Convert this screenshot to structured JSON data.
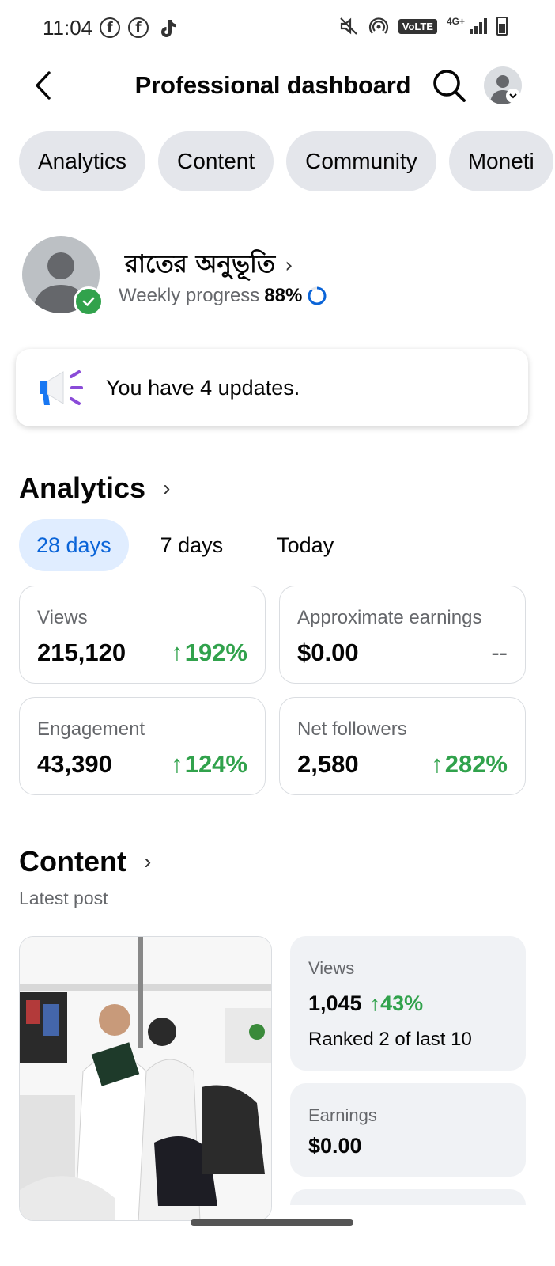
{
  "status_bar": {
    "time": "11:04",
    "network": "4G+",
    "volte": "VoLTE",
    "icons": [
      "facebook-icon",
      "facebook-icon",
      "tiktok-icon",
      "mute-icon",
      "hotspot-icon",
      "signal-icon",
      "battery-icon"
    ]
  },
  "header": {
    "title": "Professional dashboard"
  },
  "tabs": [
    {
      "label": "Analytics"
    },
    {
      "label": "Content"
    },
    {
      "label": "Community"
    },
    {
      "label": "Moneti"
    }
  ],
  "profile": {
    "name": "রাতের অনুভূতি",
    "progress_label": "Weekly progress",
    "progress_value": "88%",
    "progress_fraction": 0.88
  },
  "updates": {
    "text": "You have 4 updates."
  },
  "analytics": {
    "title": "Analytics",
    "ranges": [
      {
        "label": "28 days",
        "active": true
      },
      {
        "label": "7 days",
        "active": false
      },
      {
        "label": "Today",
        "active": false
      }
    ],
    "stats": [
      {
        "label": "Views",
        "value": "215,120",
        "change": "192%",
        "trend": "up"
      },
      {
        "label": "Approximate earnings",
        "value": "$0.00",
        "change": "--",
        "trend": "flat"
      },
      {
        "label": "Engagement",
        "value": "43,390",
        "change": "124%",
        "trend": "up"
      },
      {
        "label": "Net followers",
        "value": "2,580",
        "change": "282%",
        "trend": "up"
      }
    ]
  },
  "content": {
    "title": "Content",
    "subtitle": "Latest post",
    "views": {
      "label": "Views",
      "value": "1,045",
      "change": "43%",
      "rank": "Ranked 2 of last 10"
    },
    "earnings": {
      "label": "Earnings",
      "value": "$0.00"
    }
  },
  "colors": {
    "accent": "#0a64d8",
    "positive": "#31a24c",
    "chip_bg": "#e4e6eb",
    "card_bg": "#f0f2f5"
  }
}
